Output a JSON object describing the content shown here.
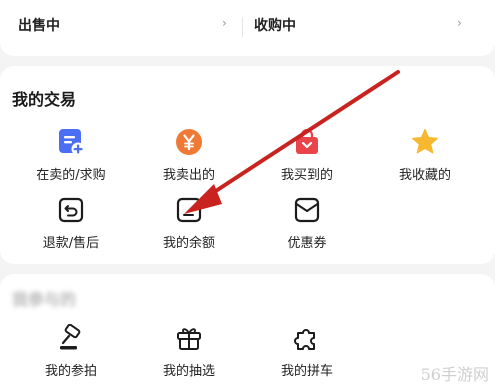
{
  "top_bar": {
    "selling_label": "出售中",
    "buying_label": "收购中",
    "chevron": "›"
  },
  "trade_section": {
    "title": "我的交易",
    "items": [
      {
        "label": "在卖的/求购",
        "icon": "listing-add-icon",
        "color": "#4b6ef5"
      },
      {
        "label": "我卖出的",
        "icon": "yen-coin-icon",
        "color": "#ef7a35"
      },
      {
        "label": "我买到的",
        "icon": "shopping-bag-icon",
        "color": "#e9444a"
      },
      {
        "label": "我收藏的",
        "icon": "star-icon",
        "color": "#f5b82e"
      },
      {
        "label": "退款/售后",
        "icon": "refund-icon",
        "color": "#1c1c1c"
      },
      {
        "label": "我的余额",
        "icon": "wallet-icon",
        "color": "#1c1c1c"
      },
      {
        "label": "优惠券",
        "icon": "coupon-icon",
        "color": "#1c1c1c"
      }
    ]
  },
  "join_section": {
    "title": "我参与的",
    "items": [
      {
        "label": "我的参拍",
        "icon": "auction-hammer-icon"
      },
      {
        "label": "我的抽选",
        "icon": "gift-box-icon"
      },
      {
        "label": "我的拼车",
        "icon": "puzzle-icon"
      }
    ]
  },
  "annotation_arrow": {
    "color": "#c8231f"
  },
  "watermark": "56手游网"
}
